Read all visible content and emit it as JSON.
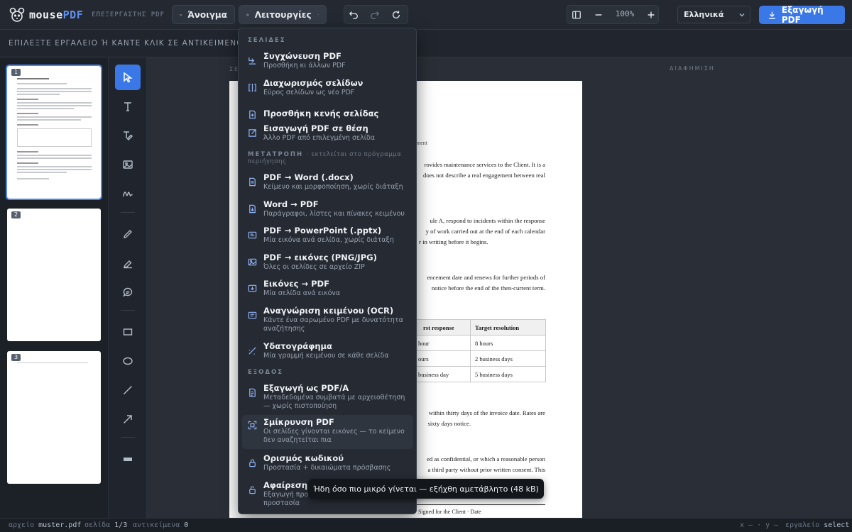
{
  "app": {
    "name_main": "mouse",
    "name_accent": "PDF",
    "subtitle": "ΕΠΕΞΕΡΓΑΣΤΗΣ PDF"
  },
  "toolbar": {
    "open_label": "Άνοιγμα",
    "functions_label": "Λειτουργίες",
    "zoom": "100%",
    "language": "Ελληνικά",
    "export_label": "Εξαγωγή PDF"
  },
  "hint": "ΕΠΙΛΕΞΤΕ ΕΡΓΑΛΕΙΟ Ή ΚΑΝΤΕ ΚΛΙΚ ΣΕ ΑΝΤΙΚΕΙΜΕΝΟ — ΕΔΩ Θ",
  "thumbnails": [
    "1",
    "2",
    "3"
  ],
  "canvas": {
    "left_label": "ΣΕ",
    "right_label": "ΔΙΑΦΗΜΙΣΗ"
  },
  "document": {
    "heading_fragment": "ement",
    "p1_l1": "rovides maintenance services to the Client. It is a",
    "p1_l2": "does not describe a real engagement between real",
    "p2_l1": "ule A, respond to incidents within the response",
    "p2_l2": "y of work carried out at the end of each calendar",
    "p2_l3": "r in writing before it begins.",
    "p3_l1": "encement date and renews for further periods of",
    "p3_l2": "notice before the end of the then-current term.",
    "table_headers": [
      "rst response",
      "Target resolution"
    ],
    "table_rows": [
      [
        "hour",
        "8 hours"
      ],
      [
        "ours",
        "2 business days"
      ],
      [
        "business day",
        "5 business days"
      ]
    ],
    "p4_l1": "within thirty days of the invoice date. Rates are",
    "p4_l2": "sixty days notice.",
    "p5_l1": "ed as confidential, or which a reasonable person",
    "p5_l2": "a third party without prior written consent. This",
    "signature": "Signed for the Client · Date"
  },
  "menu": {
    "sections": {
      "pages": "ΣΕΛΙΔΕΣ",
      "convert": "ΜΕΤΑΤΡΟΠΗ",
      "convert_note": "· εκτελείται στο πρόγραμμα περιήγησης",
      "output": "ΕΞΟΔΟΣ"
    },
    "items": [
      {
        "title": "Συγχώνευση PDF",
        "sub": "Προσθήκη κι άλλων PDF",
        "icon": "merge-icon"
      },
      {
        "title": "Διαχωρισμός σελίδων",
        "sub": "Εύρος σελίδων ως νέο PDF",
        "icon": "split-icon"
      },
      {
        "title": "Προσθήκη κενής σελίδας",
        "sub": "",
        "icon": "add-page-icon"
      },
      {
        "title": "Εισαγωγή PDF σε θέση",
        "sub": "Άλλο PDF από επιλεγμένη σελίδα",
        "icon": "insert-icon"
      },
      {
        "title": "PDF → Word (.docx)",
        "sub": "Κείμενο και μορφοποίηση, χωρίς διάταξη",
        "icon": "word-icon"
      },
      {
        "title": "Word → PDF",
        "sub": "Παράγραφοι, λίστες και πίνακες κειμένου",
        "icon": "pdf-icon"
      },
      {
        "title": "PDF → PowerPoint (.pptx)",
        "sub": "Μία εικόνα ανά σελίδα, χωρίς διάταξη",
        "icon": "slides-icon"
      },
      {
        "title": "PDF → εικόνες (PNG/JPG)",
        "sub": "Όλες οι σελίδες σε αρχείο ZIP",
        "icon": "image-icon"
      },
      {
        "title": "Εικόνες → PDF",
        "sub": "Μία σελίδα ανά εικόνα",
        "icon": "images-to-pdf-icon"
      },
      {
        "title": "Αναγνώριση κειμένου (OCR)",
        "sub": "Κάντε ένα σαρωμένο PDF με δυνατότητα αναζήτησης",
        "icon": "ocr-icon"
      },
      {
        "title": "Υδατογράφημα",
        "sub": "Μία γραμμή κειμένου σε κάθε σελίδα",
        "icon": "watermark-icon"
      },
      {
        "title": "Εξαγωγή ως PDF/A",
        "sub": "Μεταδεδομένα συμβατά με αρχειοθέτηση — χωρίς πιστοποίηση",
        "icon": "archive-icon"
      },
      {
        "title": "Σμίκρυνση PDF",
        "sub": "Οι σελίδες γίνονται εικόνες — το κείμενο δεν αναζητείται πια",
        "icon": "compress-icon"
      },
      {
        "title": "Ορισμός κωδικού",
        "sub": "Προστασία + δικαιώματα πρόσβασης",
        "icon": "lock-icon"
      },
      {
        "title": "Αφαίρεση κ",
        "sub": "Εξαγωγή προσ",
        "sub2": "προστασία",
        "icon": "unlock-icon"
      }
    ]
  },
  "toast": "Ήδη όσο πιο μικρό γίνεται — εξήχθη αμετάβλητο (48 kB)",
  "status": {
    "file_label": "αρχείο",
    "file_value": "muster.pdf",
    "page_label": "σελίδα",
    "page_value": "1/3",
    "objects_label": "αντικείμενα",
    "objects_value": "0",
    "coords": "x — · y —",
    "tool_label": "εργαλείο",
    "tool_value": "select"
  },
  "colors": {
    "accent": "#3b78e7",
    "background": "#1e232b",
    "menu_bg": "#262b33"
  }
}
